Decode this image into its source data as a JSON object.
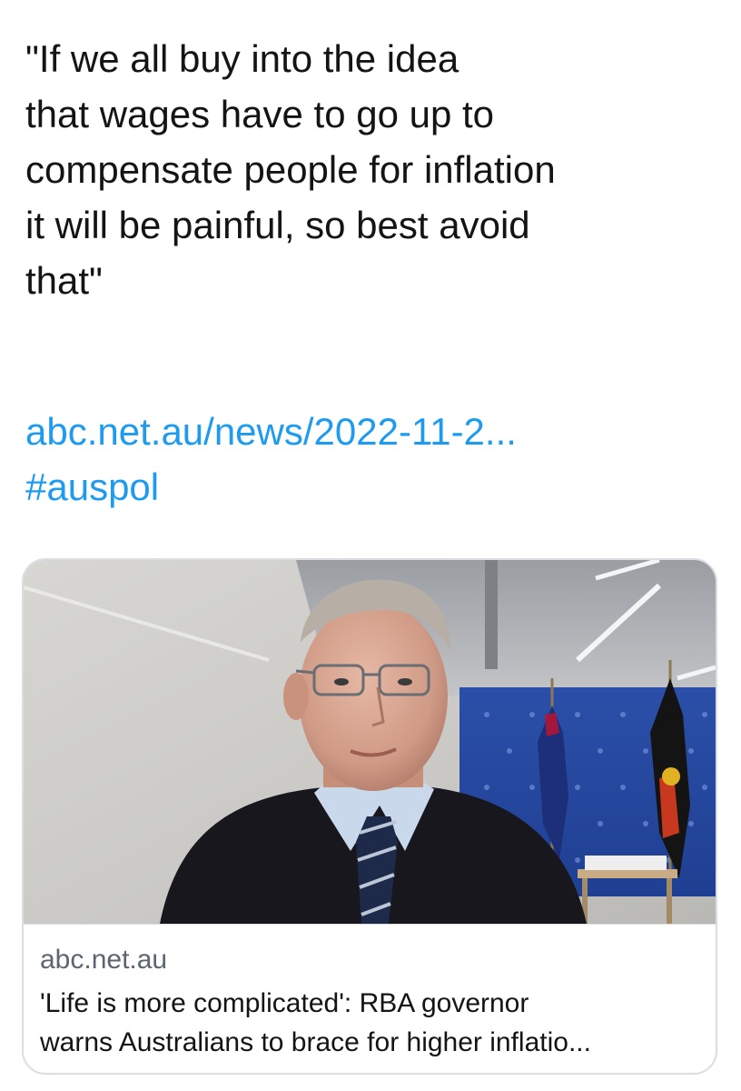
{
  "tweet": {
    "text_lines": [
      "\"If we all buy into the idea",
      "that wages have to go up to",
      "compensate people for inflation",
      "it will be painful, so best avoid",
      "that\""
    ],
    "link": "abc.net.au/news/2022-11-2...",
    "hashtag": "#auspol"
  },
  "card": {
    "domain": "abc.net.au",
    "title_lines": [
      "'Life is more complicated': RBA governor",
      "warns Australians to brace for higher inflatio..."
    ]
  },
  "colors": {
    "link": "#1d9bf0",
    "text": "#141414",
    "muted": "#5b6670",
    "border": "#d9dee3"
  }
}
